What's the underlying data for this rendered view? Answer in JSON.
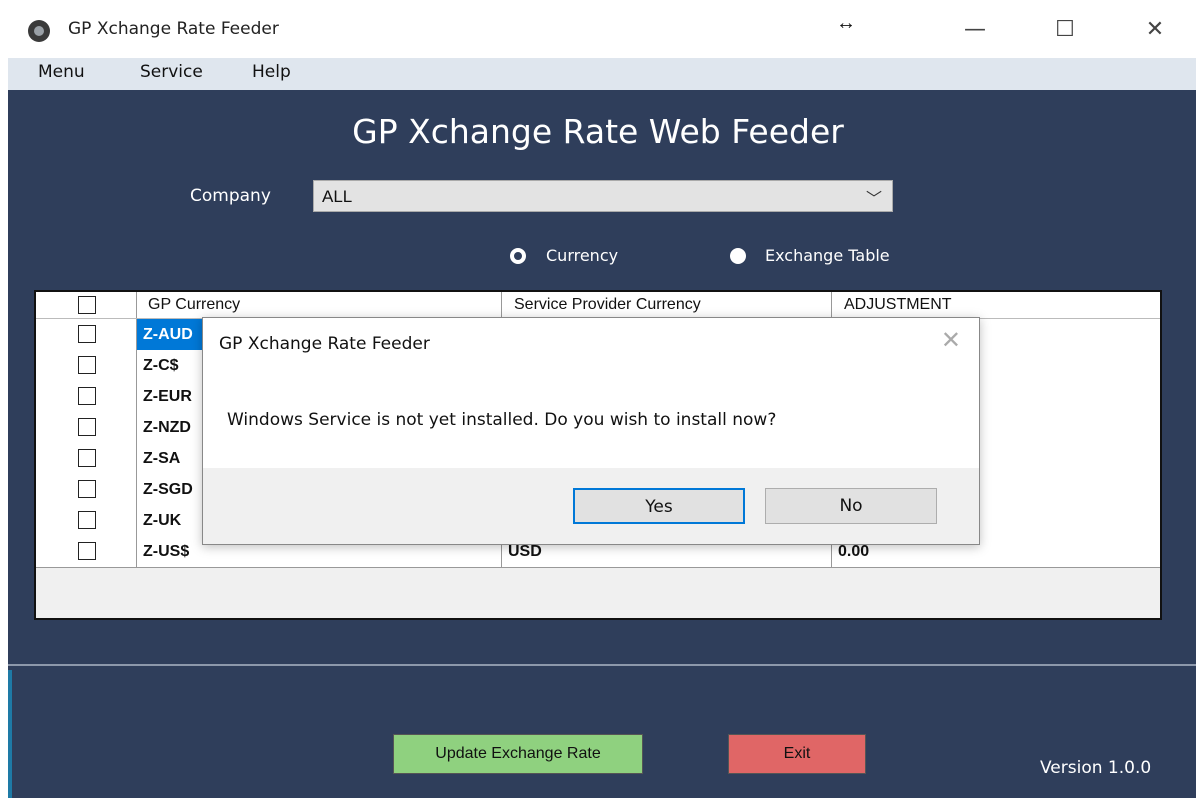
{
  "window": {
    "title": "GP Xchange Rate Feeder",
    "resize_glyph": "↔",
    "minimize_glyph": "—",
    "maximize_glyph": "☐",
    "close_glyph": "✕"
  },
  "menu": {
    "items": [
      "Menu",
      "Service",
      "Help"
    ]
  },
  "main": {
    "title": "GP Xchange Rate Web Feeder",
    "company_label": "Company",
    "company_value": "ALL",
    "combo_arrow": "﹀",
    "radio_currency": "Currency",
    "radio_exchange": "Exchange Table",
    "selected_radio": "Exchange Table"
  },
  "grid": {
    "columns": [
      "GP Currency",
      "Service Provider Currency",
      "ADJUSTMENT"
    ],
    "rows": [
      {
        "gp": "Z-AUD",
        "provider": "",
        "adjustment": ""
      },
      {
        "gp": "Z-C$",
        "provider": "",
        "adjustment": ""
      },
      {
        "gp": "Z-EUR",
        "provider": "",
        "adjustment": ""
      },
      {
        "gp": "Z-NZD",
        "provider": "",
        "adjustment": ""
      },
      {
        "gp": "Z-SA",
        "provider": "",
        "adjustment": ""
      },
      {
        "gp": "Z-SGD",
        "provider": "",
        "adjustment": ""
      },
      {
        "gp": "Z-UK",
        "provider": "",
        "adjustment": ""
      },
      {
        "gp": "Z-US$",
        "provider": "USD",
        "adjustment": "0.00"
      }
    ]
  },
  "buttons": {
    "update": "Update Exchange Rate",
    "exit": "Exit"
  },
  "version": "Version 1.0.0",
  "dialog": {
    "title": "GP Xchange Rate Feeder",
    "close_glyph": "✕",
    "message": "Windows Service is not yet installed. Do you wish to install now?",
    "yes": "Yes",
    "no": "No"
  },
  "colors": {
    "panel": "#2f3e5b",
    "update_button": "#8fd17f",
    "exit_button": "#e06666",
    "selection": "#0078d7"
  }
}
